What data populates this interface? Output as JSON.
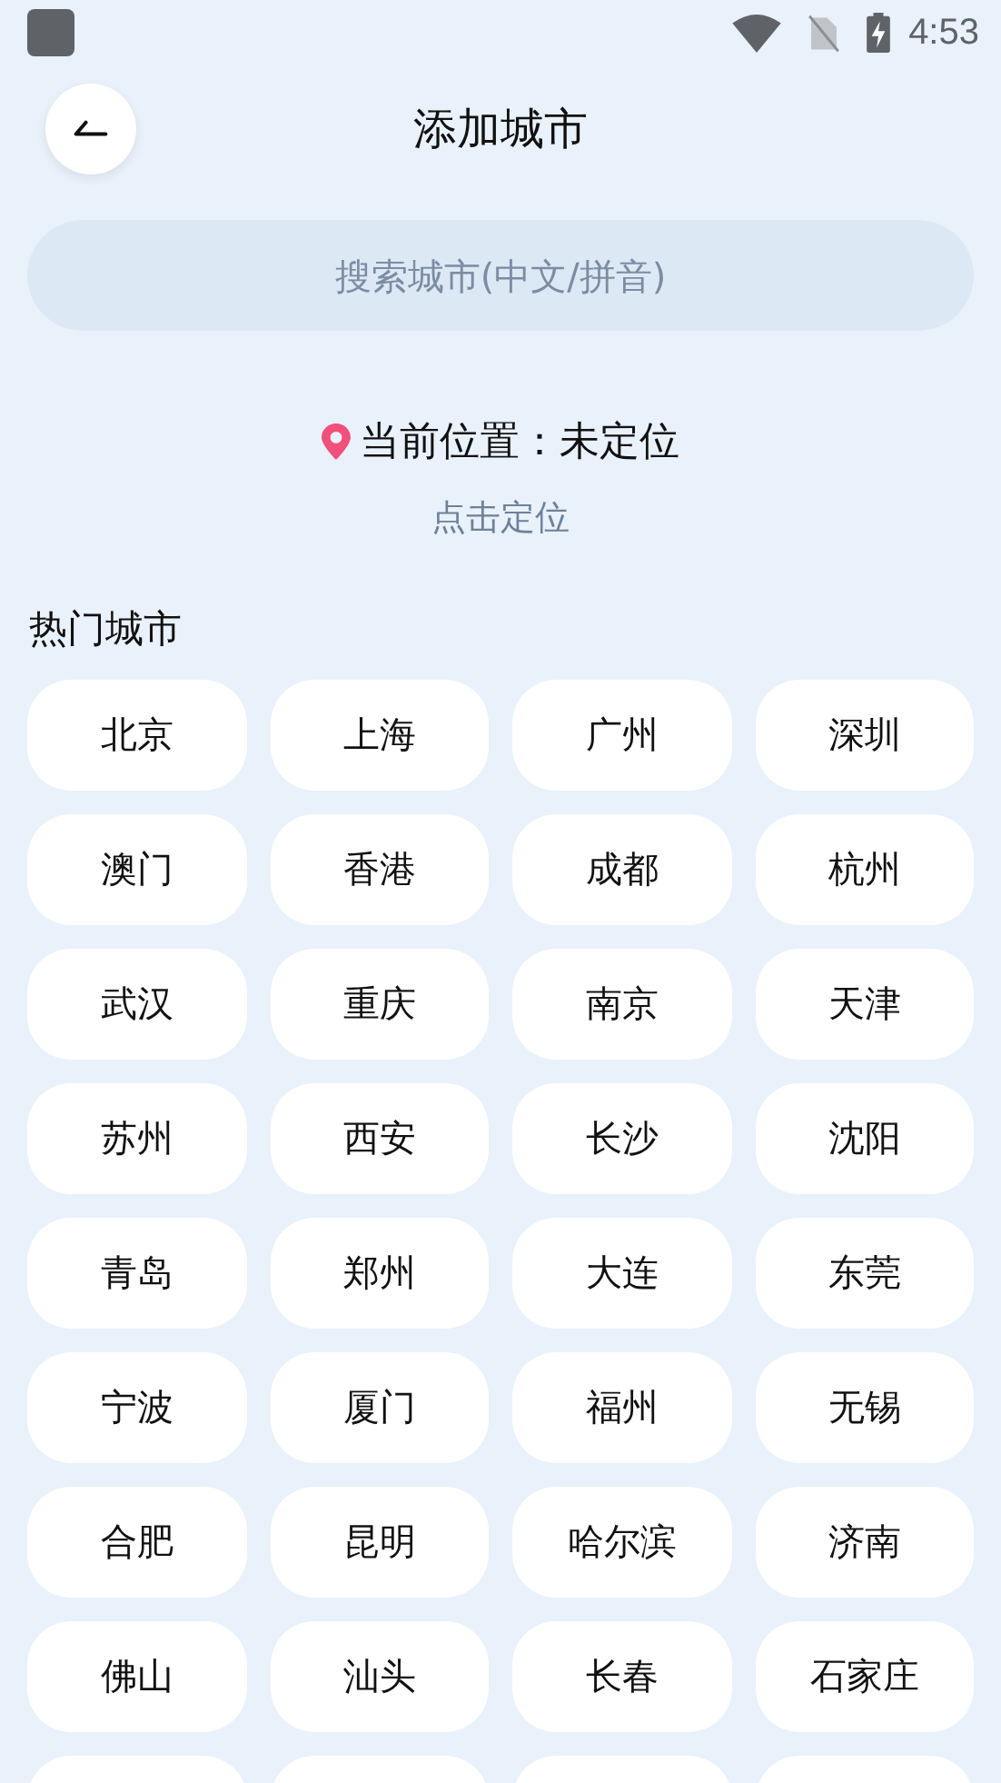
{
  "status_bar": {
    "time": "4:53"
  },
  "header": {
    "title": "添加城市"
  },
  "search": {
    "placeholder": "搜索城市(中文/拼音)"
  },
  "location": {
    "current": "当前位置：未定位",
    "action": "点击定位"
  },
  "hot_cities": {
    "heading": "热门城市",
    "items": [
      {
        "kind": "city",
        "label": "北京"
      },
      {
        "kind": "city",
        "label": "上海"
      },
      {
        "kind": "city",
        "label": "广州"
      },
      {
        "kind": "city",
        "label": "深圳"
      },
      {
        "kind": "city",
        "label": "澳门"
      },
      {
        "kind": "city",
        "label": "香港"
      },
      {
        "kind": "city",
        "label": "成都"
      },
      {
        "kind": "city",
        "label": "杭州"
      },
      {
        "kind": "city",
        "label": "武汉"
      },
      {
        "kind": "city",
        "label": "重庆"
      },
      {
        "kind": "city",
        "label": "南京"
      },
      {
        "kind": "city",
        "label": "天津"
      },
      {
        "kind": "city",
        "label": "苏州"
      },
      {
        "kind": "city",
        "label": "西安"
      },
      {
        "kind": "city",
        "label": "长沙"
      },
      {
        "kind": "city",
        "label": "沈阳"
      },
      {
        "kind": "city",
        "label": "青岛"
      },
      {
        "kind": "city",
        "label": "郑州"
      },
      {
        "kind": "city",
        "label": "大连"
      },
      {
        "kind": "city",
        "label": "东莞"
      },
      {
        "kind": "city",
        "label": "宁波"
      },
      {
        "kind": "city",
        "label": "厦门"
      },
      {
        "kind": "city",
        "label": "福州"
      },
      {
        "kind": "city",
        "label": "无锡"
      },
      {
        "kind": "city",
        "label": "合肥"
      },
      {
        "kind": "city",
        "label": "昆明"
      },
      {
        "kind": "city",
        "label": "哈尔滨"
      },
      {
        "kind": "city",
        "label": "济南"
      },
      {
        "kind": "city",
        "label": "佛山"
      },
      {
        "kind": "city",
        "label": "汕头"
      },
      {
        "kind": "city",
        "label": "长春"
      },
      {
        "kind": "city",
        "label": "石家庄"
      },
      {
        "kind": "cut"
      },
      {
        "kind": "cut"
      },
      {
        "kind": "cut"
      },
      {
        "kind": "cut"
      }
    ]
  }
}
